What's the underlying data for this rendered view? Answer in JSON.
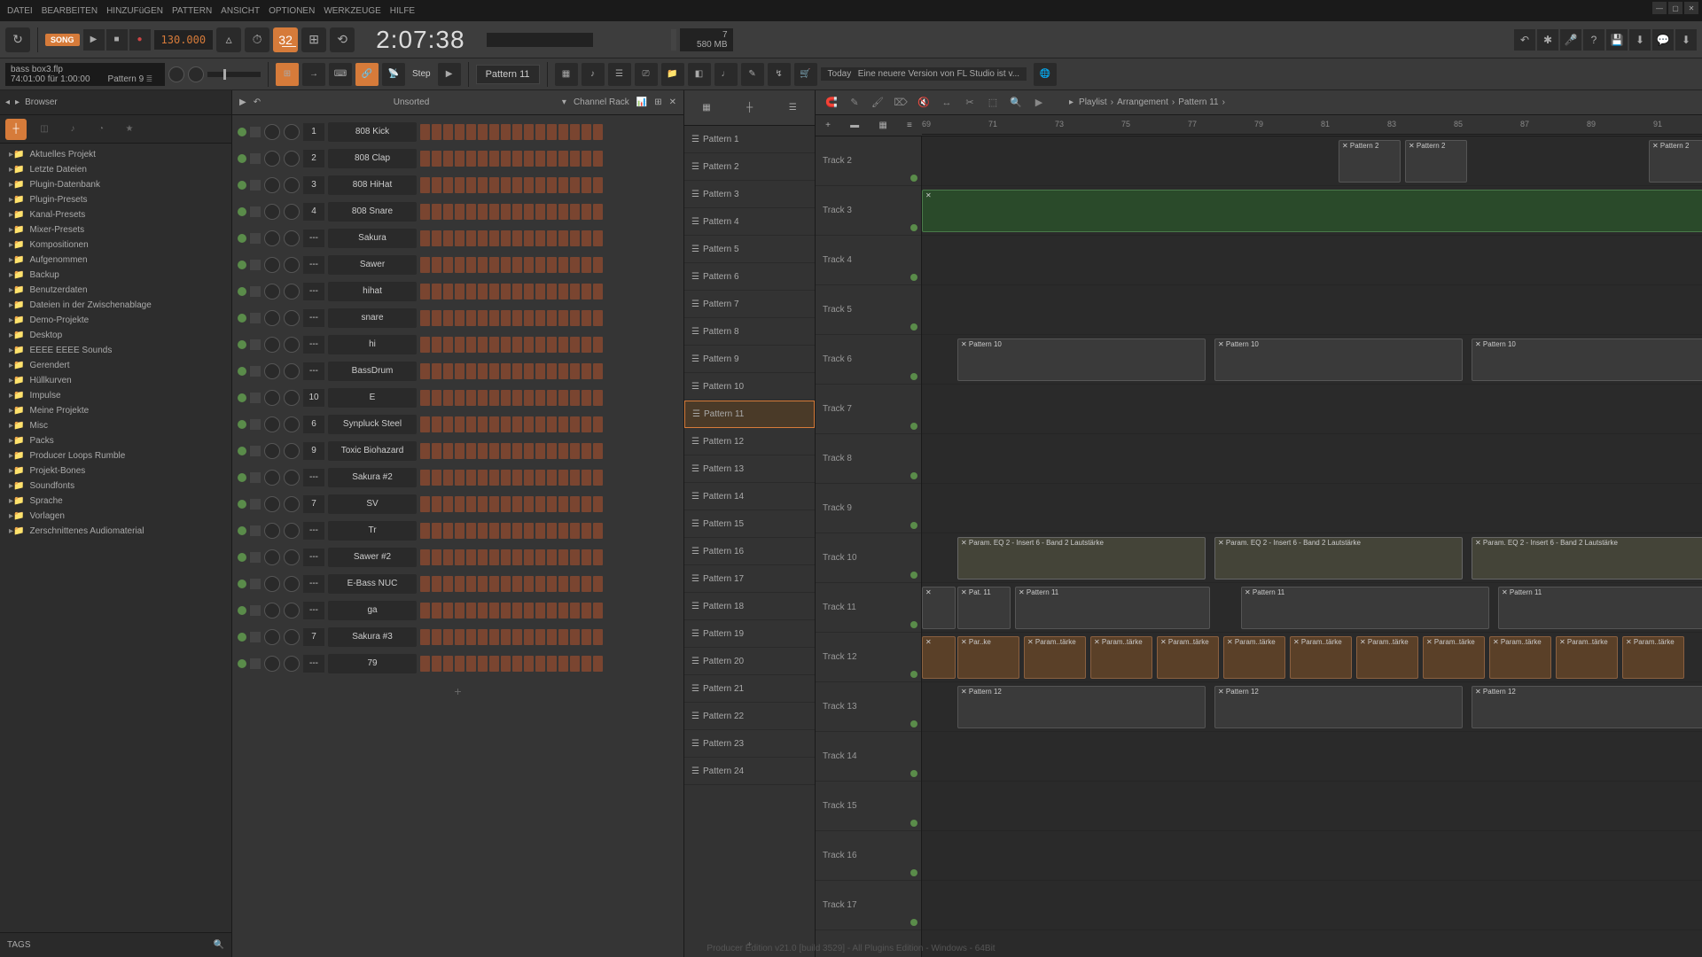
{
  "menu": [
    "DATEI",
    "BEARBEITEN",
    "HINZUFüGEN",
    "PATTERN",
    "ANSICHT",
    "OPTIONEN",
    "WERKZEUGE",
    "HILFE"
  ],
  "hint": {
    "title": "bass box3.flp",
    "sub": "74:01:00 für 1:00:00",
    "pattern": "Pattern 9"
  },
  "transport": {
    "song": "SONG",
    "tempo": "130.000",
    "time": "2:07:38"
  },
  "cpu": {
    "pct": "7",
    "mem": "580 MB"
  },
  "pattern_selector": "Pattern 11",
  "step_label": "Step",
  "news": {
    "title": "Today",
    "sub": "Eine neuere Version von FL Studio ist v..."
  },
  "browser": {
    "title": "Browser",
    "sort": "Unsorted",
    "items": [
      "Aktuelles Projekt",
      "Letzte Dateien",
      "Plugin-Datenbank",
      "Plugin-Presets",
      "Kanal-Presets",
      "Mixer-Presets",
      "Kompositionen",
      "Aufgenommen",
      "Backup",
      "Benutzerdaten",
      "Dateien in der Zwischenablage",
      "Demo-Projekte",
      "Desktop",
      "EEEE EEEE Sounds",
      "Gerendert",
      "Hüllkurven",
      "Impulse",
      "Meine Projekte",
      "Misc",
      "Packs",
      "Producer Loops Rumble",
      "Projekt-Bones",
      "Soundfonts",
      "Sprache",
      "Vorlagen",
      "Zerschnittenes Audiomaterial"
    ],
    "tags": "TAGS"
  },
  "channel_rack": {
    "title": "Channel Rack",
    "channels": [
      {
        "num": "1",
        "name": "808 Kick"
      },
      {
        "num": "2",
        "name": "808 Clap"
      },
      {
        "num": "3",
        "name": "808 HiHat"
      },
      {
        "num": "4",
        "name": "808 Snare"
      },
      {
        "num": "",
        "name": "Sakura"
      },
      {
        "num": "",
        "name": "Sawer"
      },
      {
        "num": "",
        "name": "hihat"
      },
      {
        "num": "",
        "name": "snare"
      },
      {
        "num": "",
        "name": "hi"
      },
      {
        "num": "",
        "name": "BassDrum"
      },
      {
        "num": "10",
        "name": "E"
      },
      {
        "num": "6",
        "name": "Synpluck Steel"
      },
      {
        "num": "9",
        "name": "Toxic Biohazard"
      },
      {
        "num": "",
        "name": "Sakura #2"
      },
      {
        "num": "7",
        "name": "SV"
      },
      {
        "num": "",
        "name": "Tr"
      },
      {
        "num": "",
        "name": "Sawer #2"
      },
      {
        "num": "",
        "name": "E-Bass NUC"
      },
      {
        "num": "",
        "name": "ga"
      },
      {
        "num": "7",
        "name": "Sakura #3"
      },
      {
        "num": "",
        "name": "79"
      }
    ]
  },
  "patterns": [
    "Pattern 1",
    "Pattern 2",
    "Pattern 3",
    "Pattern 4",
    "Pattern 5",
    "Pattern 6",
    "Pattern 7",
    "Pattern 8",
    "Pattern 9",
    "Pattern 10",
    "Pattern 11",
    "Pattern 12",
    "Pattern 13",
    "Pattern 14",
    "Pattern 15",
    "Pattern 16",
    "Pattern 17",
    "Pattern 18",
    "Pattern 19",
    "Pattern 20",
    "Pattern 21",
    "Pattern 22",
    "Pattern 23",
    "Pattern 24"
  ],
  "selected_pattern_idx": 10,
  "playlist": {
    "breadcrumb": [
      "Playlist",
      "Arrangement",
      "Pattern 11"
    ],
    "bars": [
      "69",
      "71",
      "73",
      "75",
      "77",
      "79",
      "81",
      "83",
      "85",
      "87",
      "89",
      "91"
    ],
    "tracks": [
      "Track 2",
      "Track 3",
      "Track 4",
      "Track 5",
      "Track 6",
      "Track 7",
      "Track 8",
      "Track 9",
      "Track 10",
      "Track 11",
      "Track 12",
      "Track 13",
      "Track 14",
      "Track 15",
      "Track 16",
      "Track 17"
    ],
    "clips": {
      "pattern2": "Pattern 2",
      "pattern10": "Pattern 10",
      "pattern11": "Pattern 11",
      "pattern12": "Pattern 12",
      "pat11": "Pat. 11",
      "eq": "Param. EQ 2 - Insert 6 - Band 2 Lautstärke",
      "parke": "Par..ke",
      "paramtarke": "Param..tärke"
    }
  },
  "footer": "Producer Edition v21.0 [build 3529] - All Plugins Edition - Windows - 64Bit"
}
